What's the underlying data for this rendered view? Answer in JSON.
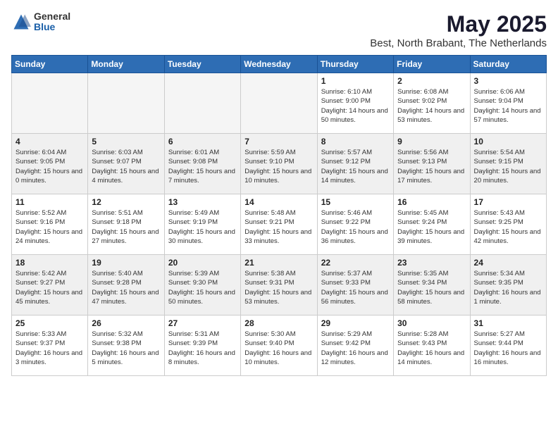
{
  "logo": {
    "general": "General",
    "blue": "Blue"
  },
  "title": "May 2025",
  "subtitle": "Best, North Brabant, The Netherlands",
  "days_of_week": [
    "Sunday",
    "Monday",
    "Tuesday",
    "Wednesday",
    "Thursday",
    "Friday",
    "Saturday"
  ],
  "weeks": [
    [
      {
        "day": "",
        "info": "",
        "empty": true
      },
      {
        "day": "",
        "info": "",
        "empty": true
      },
      {
        "day": "",
        "info": "",
        "empty": true
      },
      {
        "day": "",
        "info": "",
        "empty": true
      },
      {
        "day": "1",
        "info": "Sunrise: 6:10 AM\nSunset: 9:00 PM\nDaylight: 14 hours\nand 50 minutes.",
        "empty": false
      },
      {
        "day": "2",
        "info": "Sunrise: 6:08 AM\nSunset: 9:02 PM\nDaylight: 14 hours\nand 53 minutes.",
        "empty": false
      },
      {
        "day": "3",
        "info": "Sunrise: 6:06 AM\nSunset: 9:04 PM\nDaylight: 14 hours\nand 57 minutes.",
        "empty": false
      }
    ],
    [
      {
        "day": "4",
        "info": "Sunrise: 6:04 AM\nSunset: 9:05 PM\nDaylight: 15 hours\nand 0 minutes.",
        "empty": false
      },
      {
        "day": "5",
        "info": "Sunrise: 6:03 AM\nSunset: 9:07 PM\nDaylight: 15 hours\nand 4 minutes.",
        "empty": false
      },
      {
        "day": "6",
        "info": "Sunrise: 6:01 AM\nSunset: 9:08 PM\nDaylight: 15 hours\nand 7 minutes.",
        "empty": false
      },
      {
        "day": "7",
        "info": "Sunrise: 5:59 AM\nSunset: 9:10 PM\nDaylight: 15 hours\nand 10 minutes.",
        "empty": false
      },
      {
        "day": "8",
        "info": "Sunrise: 5:57 AM\nSunset: 9:12 PM\nDaylight: 15 hours\nand 14 minutes.",
        "empty": false
      },
      {
        "day": "9",
        "info": "Sunrise: 5:56 AM\nSunset: 9:13 PM\nDaylight: 15 hours\nand 17 minutes.",
        "empty": false
      },
      {
        "day": "10",
        "info": "Sunrise: 5:54 AM\nSunset: 9:15 PM\nDaylight: 15 hours\nand 20 minutes.",
        "empty": false
      }
    ],
    [
      {
        "day": "11",
        "info": "Sunrise: 5:52 AM\nSunset: 9:16 PM\nDaylight: 15 hours\nand 24 minutes.",
        "empty": false
      },
      {
        "day": "12",
        "info": "Sunrise: 5:51 AM\nSunset: 9:18 PM\nDaylight: 15 hours\nand 27 minutes.",
        "empty": false
      },
      {
        "day": "13",
        "info": "Sunrise: 5:49 AM\nSunset: 9:19 PM\nDaylight: 15 hours\nand 30 minutes.",
        "empty": false
      },
      {
        "day": "14",
        "info": "Sunrise: 5:48 AM\nSunset: 9:21 PM\nDaylight: 15 hours\nand 33 minutes.",
        "empty": false
      },
      {
        "day": "15",
        "info": "Sunrise: 5:46 AM\nSunset: 9:22 PM\nDaylight: 15 hours\nand 36 minutes.",
        "empty": false
      },
      {
        "day": "16",
        "info": "Sunrise: 5:45 AM\nSunset: 9:24 PM\nDaylight: 15 hours\nand 39 minutes.",
        "empty": false
      },
      {
        "day": "17",
        "info": "Sunrise: 5:43 AM\nSunset: 9:25 PM\nDaylight: 15 hours\nand 42 minutes.",
        "empty": false
      }
    ],
    [
      {
        "day": "18",
        "info": "Sunrise: 5:42 AM\nSunset: 9:27 PM\nDaylight: 15 hours\nand 45 minutes.",
        "empty": false
      },
      {
        "day": "19",
        "info": "Sunrise: 5:40 AM\nSunset: 9:28 PM\nDaylight: 15 hours\nand 47 minutes.",
        "empty": false
      },
      {
        "day": "20",
        "info": "Sunrise: 5:39 AM\nSunset: 9:30 PM\nDaylight: 15 hours\nand 50 minutes.",
        "empty": false
      },
      {
        "day": "21",
        "info": "Sunrise: 5:38 AM\nSunset: 9:31 PM\nDaylight: 15 hours\nand 53 minutes.",
        "empty": false
      },
      {
        "day": "22",
        "info": "Sunrise: 5:37 AM\nSunset: 9:33 PM\nDaylight: 15 hours\nand 56 minutes.",
        "empty": false
      },
      {
        "day": "23",
        "info": "Sunrise: 5:35 AM\nSunset: 9:34 PM\nDaylight: 15 hours\nand 58 minutes.",
        "empty": false
      },
      {
        "day": "24",
        "info": "Sunrise: 5:34 AM\nSunset: 9:35 PM\nDaylight: 16 hours\nand 1 minute.",
        "empty": false
      }
    ],
    [
      {
        "day": "25",
        "info": "Sunrise: 5:33 AM\nSunset: 9:37 PM\nDaylight: 16 hours\nand 3 minutes.",
        "empty": false
      },
      {
        "day": "26",
        "info": "Sunrise: 5:32 AM\nSunset: 9:38 PM\nDaylight: 16 hours\nand 5 minutes.",
        "empty": false
      },
      {
        "day": "27",
        "info": "Sunrise: 5:31 AM\nSunset: 9:39 PM\nDaylight: 16 hours\nand 8 minutes.",
        "empty": false
      },
      {
        "day": "28",
        "info": "Sunrise: 5:30 AM\nSunset: 9:40 PM\nDaylight: 16 hours\nand 10 minutes.",
        "empty": false
      },
      {
        "day": "29",
        "info": "Sunrise: 5:29 AM\nSunset: 9:42 PM\nDaylight: 16 hours\nand 12 minutes.",
        "empty": false
      },
      {
        "day": "30",
        "info": "Sunrise: 5:28 AM\nSunset: 9:43 PM\nDaylight: 16 hours\nand 14 minutes.",
        "empty": false
      },
      {
        "day": "31",
        "info": "Sunrise: 5:27 AM\nSunset: 9:44 PM\nDaylight: 16 hours\nand 16 minutes.",
        "empty": false
      }
    ]
  ]
}
